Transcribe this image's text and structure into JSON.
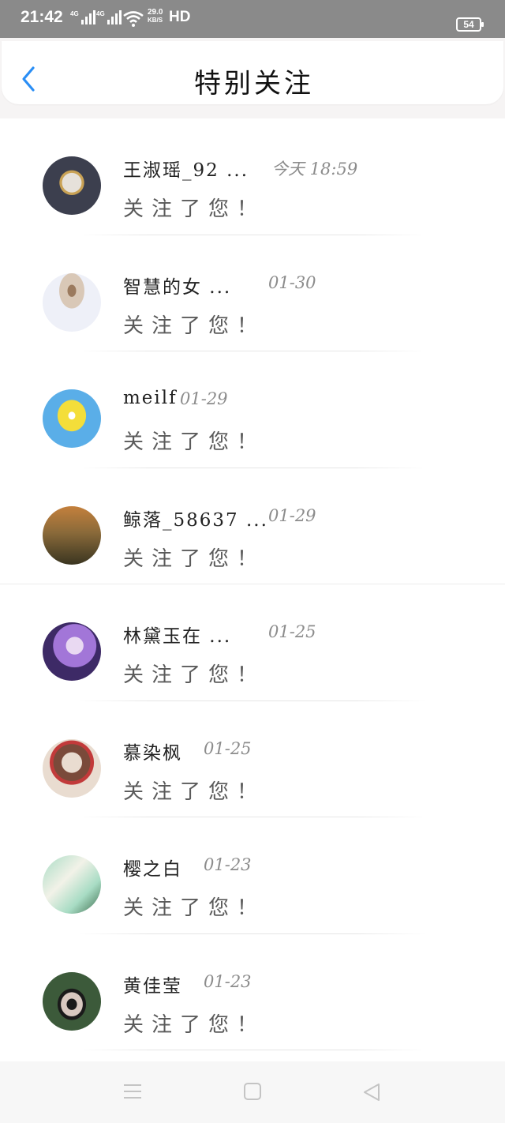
{
  "status_bar": {
    "time": "21:42",
    "network1": "4G",
    "network2": "4G",
    "speed_value": "29.0",
    "speed_unit": "KB/S",
    "hd": "HD",
    "battery": "54"
  },
  "header": {
    "title": "特别关注",
    "back_icon": "chevron-left-icon",
    "accent_color": "#2a8ef5"
  },
  "notifications": [
    {
      "name": "王淑瑶_92 ...",
      "time": "今天 18:59",
      "message": "关注了您！",
      "avatar_colors": [
        "#3c3f4e",
        "#e6e1da",
        "#c9a255"
      ]
    },
    {
      "name": "智慧的女 ...",
      "time": "01-30",
      "message": "关注了您！",
      "avatar_colors": [
        "#eef0f8",
        "#d9c8b7",
        "#9b7a5e"
      ]
    },
    {
      "name": "meilf",
      "time": "01-29",
      "message": "关注了您！",
      "avatar_colors": [
        "#5aaee8",
        "#f4de3a",
        "#ffffff"
      ]
    },
    {
      "name": "鲸落_58637 ...",
      "time": "01-29",
      "message": "关注了您！",
      "avatar_colors": [
        "#6b5a2e",
        "#c4803c",
        "#3a3520"
      ]
    },
    {
      "name": "林黛玉在 ...",
      "time": "01-25",
      "message": "关注了您！",
      "avatar_colors": [
        "#3d2a66",
        "#a276d8",
        "#e9d9f2"
      ]
    },
    {
      "name": "慕染枫",
      "time": "01-25",
      "message": "关注了您！",
      "avatar_colors": [
        "#e9dcd0",
        "#7a4a3a",
        "#c23a3a"
      ]
    },
    {
      "name": "樱之白",
      "time": "01-23",
      "message": "关注了您！",
      "avatar_colors": [
        "#a8dcc4",
        "#f2f2e8",
        "#3a6a4a"
      ]
    },
    {
      "name": "黄佳莹",
      "time": "01-23",
      "message": "关注了您！",
      "avatar_colors": [
        "#3c5a3a",
        "#d8c8c0",
        "#1a1a1a"
      ]
    }
  ],
  "nav_bar": {
    "menu_icon": "menu-icon",
    "home_icon": "home-square-icon",
    "back_icon": "back-triangle-icon"
  }
}
